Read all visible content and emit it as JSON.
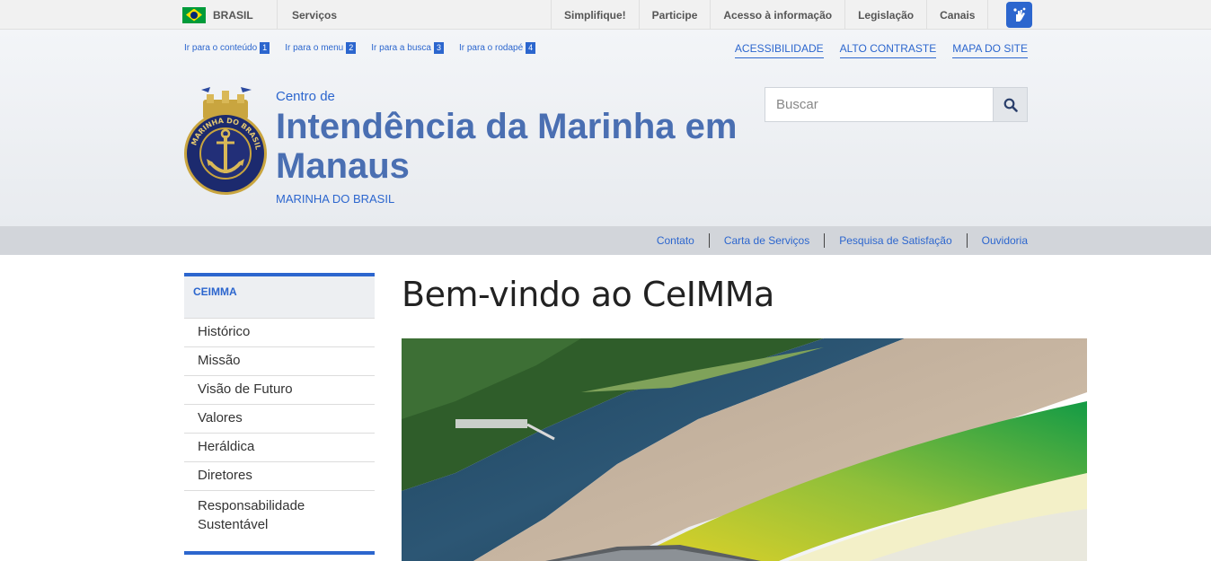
{
  "gov_bar": {
    "country_label": "BRASIL",
    "services_label": "Serviços",
    "links": [
      "Simplifique!",
      "Participe",
      "Acesso à informação",
      "Legislação",
      "Canais"
    ],
    "libras_icon": "hands-icon"
  },
  "header": {
    "skip_links": [
      {
        "label": "Ir para o conteúdo",
        "number": "1"
      },
      {
        "label": "Ir para o menu",
        "number": "2"
      },
      {
        "label": "Ir para a busca",
        "number": "3"
      },
      {
        "label": "Ir para o rodapé",
        "number": "4"
      }
    ],
    "accessibility_links": [
      "ACESSIBILIDADE",
      "ALTO CONTRASTE",
      "MAPA DO SITE"
    ],
    "center_label": "Centro de",
    "title": "Intendência da Marinha em Manaus",
    "subtitle": "MARINHA DO BRASIL",
    "emblem_text": "MARINHA DO BRASIL",
    "search": {
      "placeholder": "Buscar",
      "value": "",
      "icon": "search-icon"
    }
  },
  "service_links": [
    "Contato",
    "Carta de Serviços",
    "Pesquisa de Satisfação",
    "Ouvidoria"
  ],
  "sidebar": {
    "heading": "CEIMMA",
    "items": [
      "Histórico",
      "Missão",
      "Visão de Futuro",
      "Valores",
      "Heráldica",
      "Diretores",
      "Responsabilidade Sustentável"
    ]
  },
  "main": {
    "heading": "Bem-vindo ao CeIMMa"
  },
  "colors": {
    "accent": "#2c66ce",
    "title": "#4a6fb2",
    "service_bar": "#d2d5da"
  }
}
